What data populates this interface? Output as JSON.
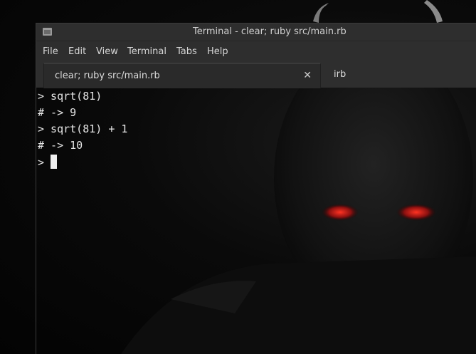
{
  "window": {
    "title": "Terminal - clear; ruby src/main.rb"
  },
  "menubar": {
    "items": [
      {
        "label": "File"
      },
      {
        "label": "Edit"
      },
      {
        "label": "View"
      },
      {
        "label": "Terminal"
      },
      {
        "label": "Tabs"
      },
      {
        "label": "Help"
      }
    ]
  },
  "tabs": [
    {
      "label": "clear; ruby src/main.rb",
      "active": true,
      "close_glyph": "✕"
    },
    {
      "label": "irb",
      "active": false
    }
  ],
  "terminal": {
    "lines": [
      "> sqrt(81)",
      "# -> 9",
      "> sqrt(81) + 1",
      "# -> 10"
    ],
    "prompt": "> "
  },
  "icons": {
    "window_icon": "terminal-window-icon",
    "close": "close-icon"
  },
  "colors": {
    "background": "#050505",
    "chrome": "#2e2e2e",
    "text": "#e6e6e6",
    "wallpaper_eyes": "#c0201a"
  }
}
